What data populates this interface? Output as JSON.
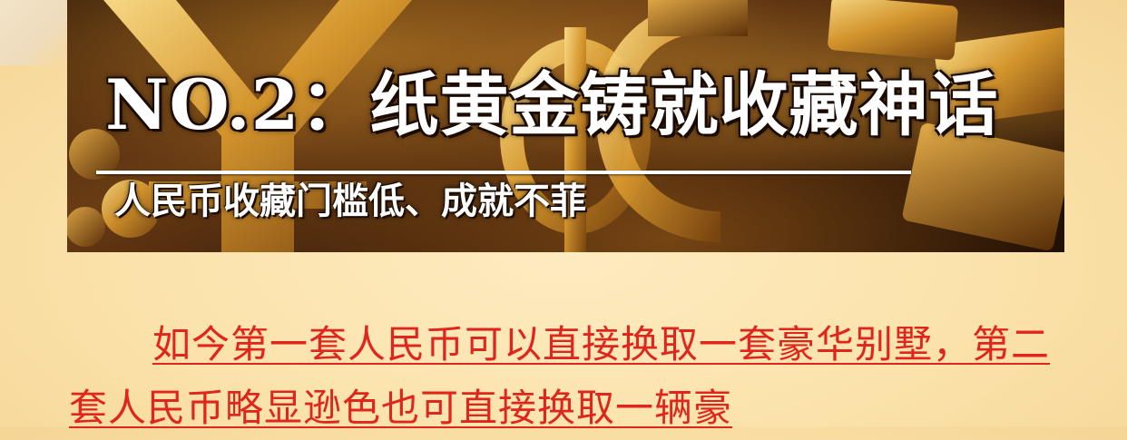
{
  "banner": {
    "title": "NO.2：纸黄金铸就收藏神话",
    "subtitle": "人民币收藏门槛低、成就不菲"
  },
  "article": {
    "paragraph": "如今第一套人民币可以直接换取一套豪华别墅，第二套人民币略显逊色也可直接换取一辆豪"
  },
  "colors": {
    "body_text_red": "#e0261c",
    "page_background": "#fbe2aa",
    "banner_gold": "#c98a28"
  }
}
